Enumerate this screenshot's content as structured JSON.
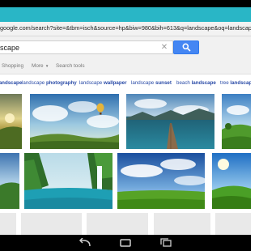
{
  "browser": {
    "url_text": "google.com/search?site=&tbm=isch&source=hp&biw=980&bih=613&q=landscape&oq=landscape&gs_l"
  },
  "search": {
    "query": "scape",
    "clear_icon": "close-icon",
    "button_icon": "search-icon"
  },
  "tools": {
    "shopping": "Shopping",
    "more": "More",
    "search_tools": "Search tools"
  },
  "related": [
    {
      "prefix": "",
      "suffix": "landscape"
    },
    {
      "prefix": "landscape ",
      "suffix": "photography"
    },
    {
      "prefix": "landscape ",
      "suffix": "wallpaper"
    },
    {
      "prefix": "landscape ",
      "suffix": "sunset"
    },
    {
      "prefix": "beach ",
      "suffix": "landscape"
    },
    {
      "prefix": "tree ",
      "suffix": "landscapes"
    }
  ],
  "images": [
    {
      "name": "sunset-meadow"
    },
    {
      "name": "hot-air-balloon-sky"
    },
    {
      "name": "lake-pier"
    },
    {
      "name": "green-hills"
    },
    {
      "name": "waterfall-lagoon"
    },
    {
      "name": "green-field-blue-sky"
    },
    {
      "name": "sunny-hillside"
    }
  ],
  "nav_bar": {
    "buttons": [
      "back-icon",
      "home-icon",
      "recents-icon"
    ]
  },
  "colors": {
    "address_strip": "#29b6c6",
    "search_button": "#4486f3",
    "link": "#2a4ba7"
  }
}
